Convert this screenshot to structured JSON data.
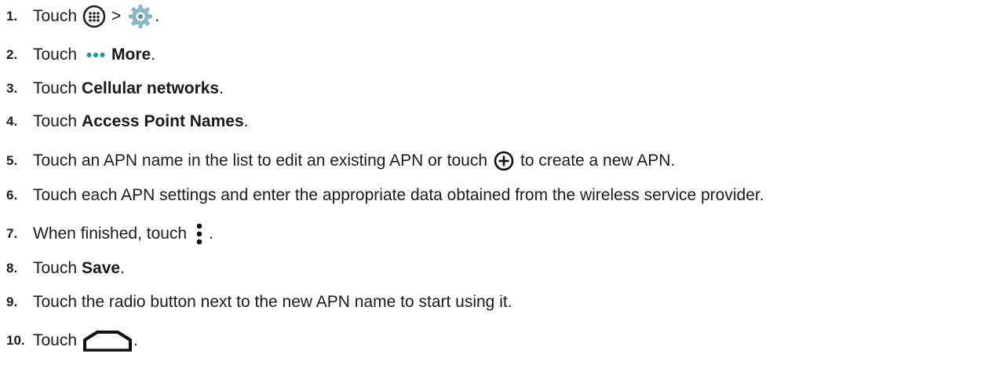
{
  "steps": [
    {
      "num": "1.",
      "text": "Touch",
      "sep": ">",
      "end": "."
    },
    {
      "num": "2.",
      "text": "Touch",
      "bold": "More",
      "end": "."
    },
    {
      "num": "3.",
      "text": "Touch",
      "bold": "Cellular networks",
      "end": "."
    },
    {
      "num": "4.",
      "text": "Touch",
      "bold": "Access Point Names",
      "end": "."
    },
    {
      "num": "5.",
      "text": "Touch an APN name in the list to edit an existing APN or touch",
      "text2": "to create a new APN."
    },
    {
      "num": "6.",
      "text": "Touch each APN settings and enter the appropriate data obtained from the wireless service provider."
    },
    {
      "num": "7.",
      "text": "When finished, touch",
      "end": "."
    },
    {
      "num": "8.",
      "text": "Touch",
      "bold": "Save",
      "end": "."
    },
    {
      "num": "9.",
      "text": "Touch the radio button next to the new APN name to start using it."
    },
    {
      "num": "10.",
      "text": "Touch",
      "end": "."
    }
  ],
  "icons": {
    "apps": "apps-icon",
    "settings": "settings-gear-icon",
    "more": "more-dots-icon",
    "add": "add-circle-icon",
    "overflow": "overflow-menu-icon",
    "home": "home-icon"
  },
  "colors": {
    "teal": "#169b91",
    "text": "#1a1a1a"
  }
}
